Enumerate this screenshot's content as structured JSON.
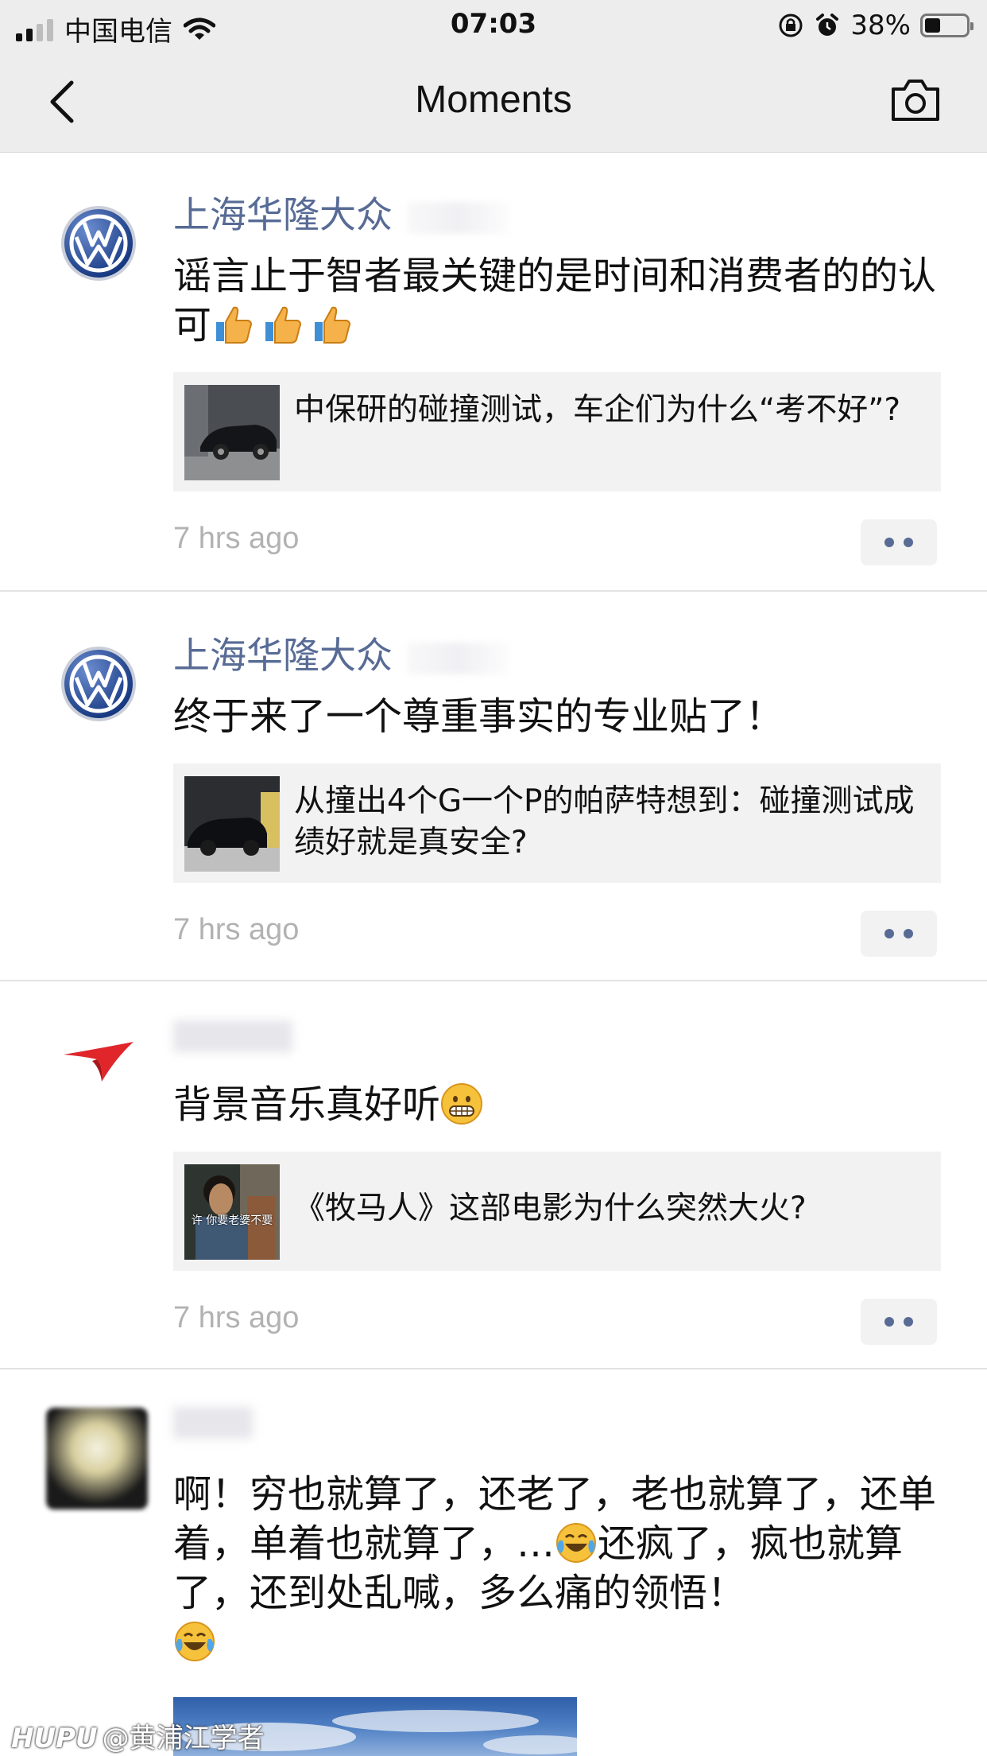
{
  "status_bar": {
    "carrier": "中国电信",
    "time": "07:03",
    "battery_percent": "38%",
    "battery_level": 0.38,
    "icons": [
      "signal-icon",
      "wifi-icon",
      "orientation-lock-icon",
      "alarm-icon",
      "battery-icon"
    ]
  },
  "nav": {
    "title": "Moments",
    "back_icon": "chevron-left-icon",
    "camera_icon": "camera-icon"
  },
  "posts": [
    {
      "author": "上海华隆大众",
      "avatar_icon": "vw-logo-icon",
      "text": "谣言止于智者最关键的是时间和消费者的的认可",
      "emoji": [
        "thumbs-up",
        "thumbs-up",
        "thumbs-up"
      ],
      "link": {
        "title": "中保研的碰撞测试，车企们为什么“考不好”?"
      },
      "time": "7 hrs ago"
    },
    {
      "author": "上海华隆大众",
      "avatar_icon": "vw-logo-icon",
      "text": "终于来了一个尊重事实的专业贴了！",
      "link": {
        "title": "从撞出4个G一个P的帕萨特想到：碰撞测试成绩好就是真安全?"
      },
      "time": "7 hrs ago"
    },
    {
      "author": "",
      "avatar_icon": "red-swoosh-icon",
      "text": "背景音乐真好听",
      "emoji": [
        "grimace"
      ],
      "link": {
        "title": "《牧马人》这部电影为什么突然大火?",
        "thumb_caption": "许 你要老婆不要"
      },
      "time": "7 hrs ago"
    },
    {
      "author": "",
      "avatar_icon": "blurred-avatar-icon",
      "text": "啊！穷也就算了，还老了，老也就算了，还单着，单着也就算了，…还疯了，疯也就算了，还到处乱喊，多么痛的领悟！",
      "emoji": [
        "laughing-crying",
        "laughing-crying"
      ]
    }
  ],
  "watermark": {
    "brand": "HUPU",
    "text": "@黄浦江学者"
  },
  "colors": {
    "link_blue": "#576b95",
    "bar_bg": "#ededed",
    "card_bg": "#f2f2f2",
    "time_gray": "#b2b2b2"
  }
}
